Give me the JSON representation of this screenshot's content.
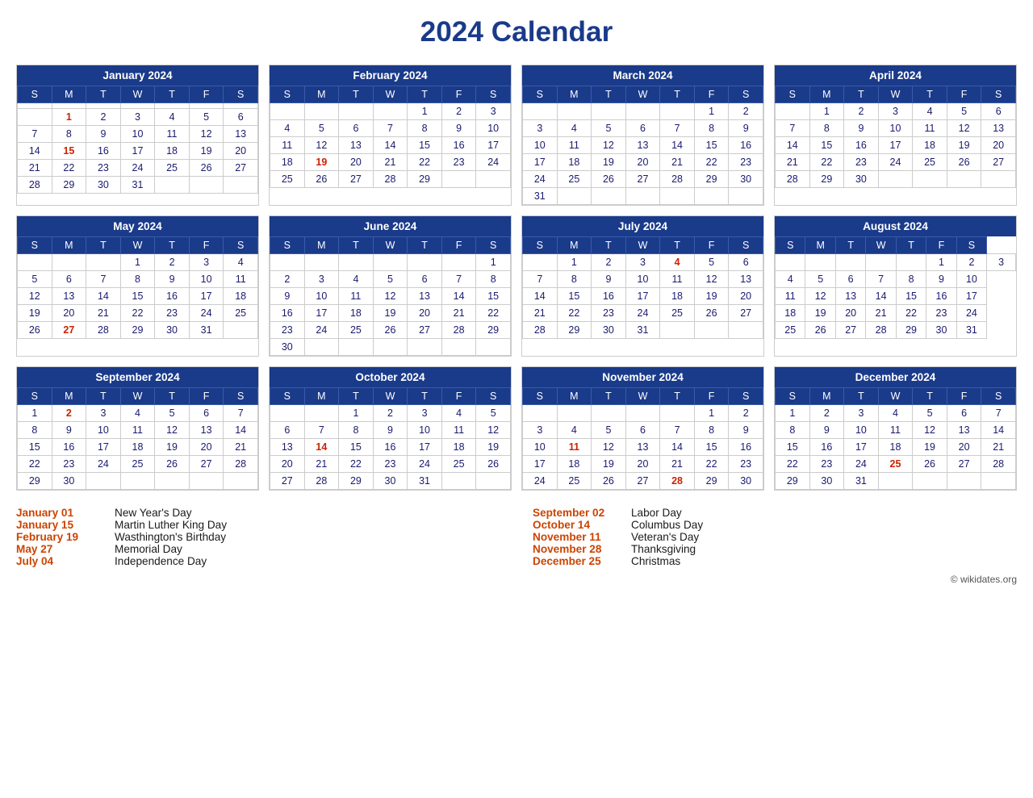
{
  "title": "2024 Calendar",
  "copyright": "© wikidates.org",
  "months": [
    {
      "name": "January 2024",
      "days": [
        [
          "",
          "",
          "",
          "",
          "",
          "",
          ""
        ],
        [
          "",
          "1",
          "2",
          "3",
          "4",
          "5",
          "6"
        ],
        [
          "7",
          "8",
          "9",
          "10",
          "11",
          "12",
          "13"
        ],
        [
          "14",
          "15",
          "16",
          "17",
          "18",
          "19",
          "20"
        ],
        [
          "21",
          "22",
          "23",
          "24",
          "25",
          "26",
          "27"
        ],
        [
          "28",
          "29",
          "30",
          "31",
          "",
          "",
          ""
        ]
      ],
      "holidays": [
        1,
        15
      ]
    },
    {
      "name": "February 2024",
      "days": [
        [
          "",
          "",
          "",
          "",
          "1",
          "2",
          "3"
        ],
        [
          "4",
          "5",
          "6",
          "7",
          "8",
          "9",
          "10"
        ],
        [
          "11",
          "12",
          "13",
          "14",
          "15",
          "16",
          "17"
        ],
        [
          "18",
          "19",
          "20",
          "21",
          "22",
          "23",
          "24"
        ],
        [
          "25",
          "26",
          "27",
          "28",
          "29",
          "",
          ""
        ]
      ],
      "holidays": [
        19
      ]
    },
    {
      "name": "March 2024",
      "days": [
        [
          "",
          "",
          "",
          "",
          "",
          "1",
          "2"
        ],
        [
          "3",
          "4",
          "5",
          "6",
          "7",
          "8",
          "9"
        ],
        [
          "10",
          "11",
          "12",
          "13",
          "14",
          "15",
          "16"
        ],
        [
          "17",
          "18",
          "19",
          "20",
          "21",
          "22",
          "23"
        ],
        [
          "24",
          "25",
          "26",
          "27",
          "28",
          "29",
          "30"
        ],
        [
          "31",
          "",
          "",
          "",
          "",
          "",
          ""
        ]
      ],
      "holidays": []
    },
    {
      "name": "April 2024",
      "days": [
        [
          "",
          "1",
          "2",
          "3",
          "4",
          "5",
          "6"
        ],
        [
          "7",
          "8",
          "9",
          "10",
          "11",
          "12",
          "13"
        ],
        [
          "14",
          "15",
          "16",
          "17",
          "18",
          "19",
          "20"
        ],
        [
          "21",
          "22",
          "23",
          "24",
          "25",
          "26",
          "27"
        ],
        [
          "28",
          "29",
          "30",
          "",
          "",
          "",
          ""
        ]
      ],
      "holidays": []
    },
    {
      "name": "May 2024",
      "days": [
        [
          "",
          "",
          "",
          "1",
          "2",
          "3",
          "4"
        ],
        [
          "5",
          "6",
          "7",
          "8",
          "9",
          "10",
          "11"
        ],
        [
          "12",
          "13",
          "14",
          "15",
          "16",
          "17",
          "18"
        ],
        [
          "19",
          "20",
          "21",
          "22",
          "23",
          "24",
          "25"
        ],
        [
          "26",
          "27",
          "28",
          "29",
          "30",
          "31",
          ""
        ]
      ],
      "holidays": [
        27
      ]
    },
    {
      "name": "June 2024",
      "days": [
        [
          "",
          "",
          "",
          "",
          "",
          "",
          "1"
        ],
        [
          "2",
          "3",
          "4",
          "5",
          "6",
          "7",
          "8"
        ],
        [
          "9",
          "10",
          "11",
          "12",
          "13",
          "14",
          "15"
        ],
        [
          "16",
          "17",
          "18",
          "19",
          "20",
          "21",
          "22"
        ],
        [
          "23",
          "24",
          "25",
          "26",
          "27",
          "28",
          "29"
        ],
        [
          "30",
          "",
          "",
          "",
          "",
          "",
          ""
        ]
      ],
      "holidays": []
    },
    {
      "name": "July 2024",
      "days": [
        [
          "",
          "1",
          "2",
          "3",
          "4",
          "5",
          "6"
        ],
        [
          "7",
          "8",
          "9",
          "10",
          "11",
          "12",
          "13"
        ],
        [
          "14",
          "15",
          "16",
          "17",
          "18",
          "19",
          "20"
        ],
        [
          "21",
          "22",
          "23",
          "24",
          "25",
          "26",
          "27"
        ],
        [
          "28",
          "29",
          "30",
          "31",
          "",
          "",
          ""
        ]
      ],
      "holidays": [
        4
      ]
    },
    {
      "name": "August 2024",
      "days": [
        [
          "",
          "",
          "",
          "",
          "",
          "1",
          "2",
          "3"
        ],
        [
          "4",
          "5",
          "6",
          "7",
          "8",
          "9",
          "10"
        ],
        [
          "11",
          "12",
          "13",
          "14",
          "15",
          "16",
          "17"
        ],
        [
          "18",
          "19",
          "20",
          "21",
          "22",
          "23",
          "24"
        ],
        [
          "25",
          "26",
          "27",
          "28",
          "29",
          "30",
          "31"
        ]
      ],
      "holidays": []
    },
    {
      "name": "September 2024",
      "days": [
        [
          "1",
          "2",
          "3",
          "4",
          "5",
          "6",
          "7"
        ],
        [
          "8",
          "9",
          "10",
          "11",
          "12",
          "13",
          "14"
        ],
        [
          "15",
          "16",
          "17",
          "18",
          "19",
          "20",
          "21"
        ],
        [
          "22",
          "23",
          "24",
          "25",
          "26",
          "27",
          "28"
        ],
        [
          "29",
          "30",
          "",
          "",
          "",
          "",
          ""
        ]
      ],
      "holidays": [
        2
      ]
    },
    {
      "name": "October 2024",
      "days": [
        [
          "",
          "",
          "1",
          "2",
          "3",
          "4",
          "5"
        ],
        [
          "6",
          "7",
          "8",
          "9",
          "10",
          "11",
          "12"
        ],
        [
          "13",
          "14",
          "15",
          "16",
          "17",
          "18",
          "19"
        ],
        [
          "20",
          "21",
          "22",
          "23",
          "24",
          "25",
          "26"
        ],
        [
          "27",
          "28",
          "29",
          "30",
          "31",
          "",
          ""
        ]
      ],
      "holidays": [
        14
      ]
    },
    {
      "name": "November 2024",
      "days": [
        [
          "",
          "",
          "",
          "",
          "",
          "1",
          "2"
        ],
        [
          "3",
          "4",
          "5",
          "6",
          "7",
          "8",
          "9"
        ],
        [
          "10",
          "11",
          "12",
          "13",
          "14",
          "15",
          "16"
        ],
        [
          "17",
          "18",
          "19",
          "20",
          "21",
          "22",
          "23"
        ],
        [
          "24",
          "25",
          "26",
          "27",
          "28",
          "29",
          "30"
        ]
      ],
      "holidays": [
        11,
        28
      ]
    },
    {
      "name": "December 2024",
      "days": [
        [
          "1",
          "2",
          "3",
          "4",
          "5",
          "6",
          "7"
        ],
        [
          "8",
          "9",
          "10",
          "11",
          "12",
          "13",
          "14"
        ],
        [
          "15",
          "16",
          "17",
          "18",
          "19",
          "20",
          "21"
        ],
        [
          "22",
          "23",
          "24",
          "25",
          "26",
          "27",
          "28"
        ],
        [
          "29",
          "30",
          "31",
          "",
          "",
          "",
          ""
        ]
      ],
      "holidays": [
        25
      ]
    }
  ],
  "holidays": [
    {
      "date": "January 01",
      "name": "New Year's Day"
    },
    {
      "date": "January 15",
      "name": "Martin Luther King Day"
    },
    {
      "date": "February 19",
      "name": "Wasthington's Birthday"
    },
    {
      "date": "May 27",
      "name": "Memorial Day"
    },
    {
      "date": "July 04",
      "name": "Independence Day"
    },
    {
      "date": "September 02",
      "name": "Labor Day"
    },
    {
      "date": "October 14",
      "name": "Columbus Day"
    },
    {
      "date": "November 11",
      "name": "Veteran's Day"
    },
    {
      "date": "November 28",
      "name": "Thanksgiving"
    },
    {
      "date": "December 25",
      "name": "Christmas"
    }
  ],
  "weekdays": [
    "S",
    "M",
    "T",
    "W",
    "T",
    "F",
    "S"
  ]
}
